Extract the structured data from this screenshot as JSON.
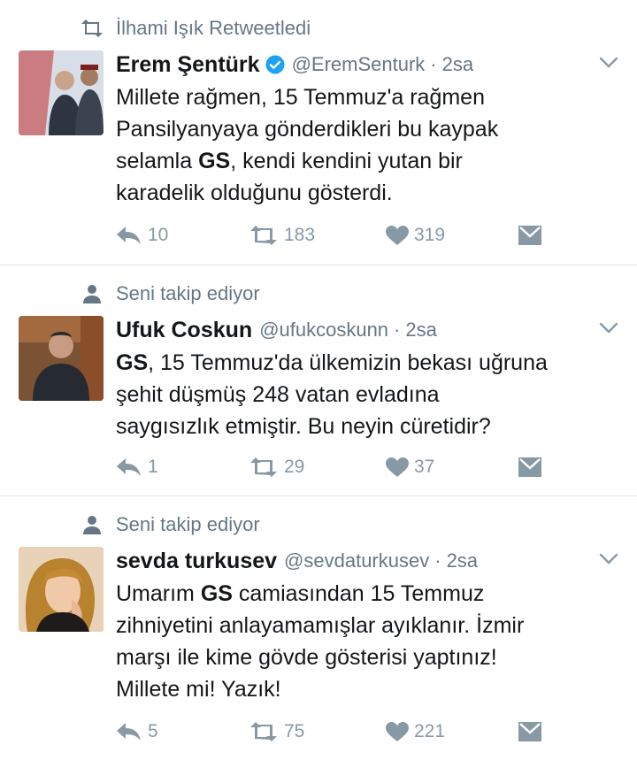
{
  "tweets": [
    {
      "context": "İlhami Işık Retweetledi",
      "context_type": "retweet",
      "name": "Erem Şentürk",
      "verified": true,
      "handle": "@EremSenturk",
      "separator": "·",
      "time": "2sa",
      "lines": [
        [
          {
            "t": "Millete rağmen, 15 Temmuz'a rağmen"
          }
        ],
        [
          {
            "t": "Pansilyanyaya gönderdikleri bu kaypak"
          }
        ],
        [
          {
            "t": "selamla "
          },
          {
            "t": "GS",
            "b": true
          },
          {
            "t": ", kendi kendini yutan bir"
          }
        ],
        [
          {
            "t": "karadelik olduğunu gösterdi."
          }
        ]
      ],
      "replies": "10",
      "retweets": "183",
      "likes": "319"
    },
    {
      "context": "Seni takip ediyor",
      "context_type": "follow",
      "name": "Ufuk Coskun",
      "verified": false,
      "handle": "@ufukcoskunn",
      "separator": "·",
      "time": "2sa",
      "lines": [
        [
          {
            "t": "GS",
            "b": true
          },
          {
            "t": ", 15 Temmuz'da ülkemizin bekası uğruna"
          }
        ],
        [
          {
            "t": "şehit düşmüş 248 vatan evladına"
          }
        ],
        [
          {
            "t": "saygısızlık etmiştir. Bu neyin cüretidir?"
          }
        ]
      ],
      "replies": "1",
      "retweets": "29",
      "likes": "37"
    },
    {
      "context": "Seni takip ediyor",
      "context_type": "follow",
      "name": "sevda turkusev",
      "verified": false,
      "handle": "@sevdaturkusev",
      "separator": "·",
      "time": "2sa",
      "lines": [
        [
          {
            "t": "Umarım "
          },
          {
            "t": "GS",
            "b": true
          },
          {
            "t": " camiasından 15 Temmuz"
          }
        ],
        [
          {
            "t": "zihniyetini anlayamamışlar ayıklanır. İzmir"
          }
        ],
        [
          {
            "t": "marşı ile kime gövde gösterisi yaptınız!"
          }
        ],
        [
          {
            "t": "Millete mi! Yazık!"
          }
        ]
      ],
      "replies": "5",
      "retweets": "75",
      "likes": "221"
    }
  ],
  "colors": {
    "text": "#14171a",
    "secondary": "#657786",
    "action": "#8899a6",
    "divider": "#e1e8ed",
    "verified": "#1da1f2"
  },
  "icons": [
    "retweet-icon",
    "person-icon",
    "verified-badge-icon",
    "chevron-down-icon",
    "reply-icon",
    "like-icon",
    "direct-message-icon"
  ]
}
